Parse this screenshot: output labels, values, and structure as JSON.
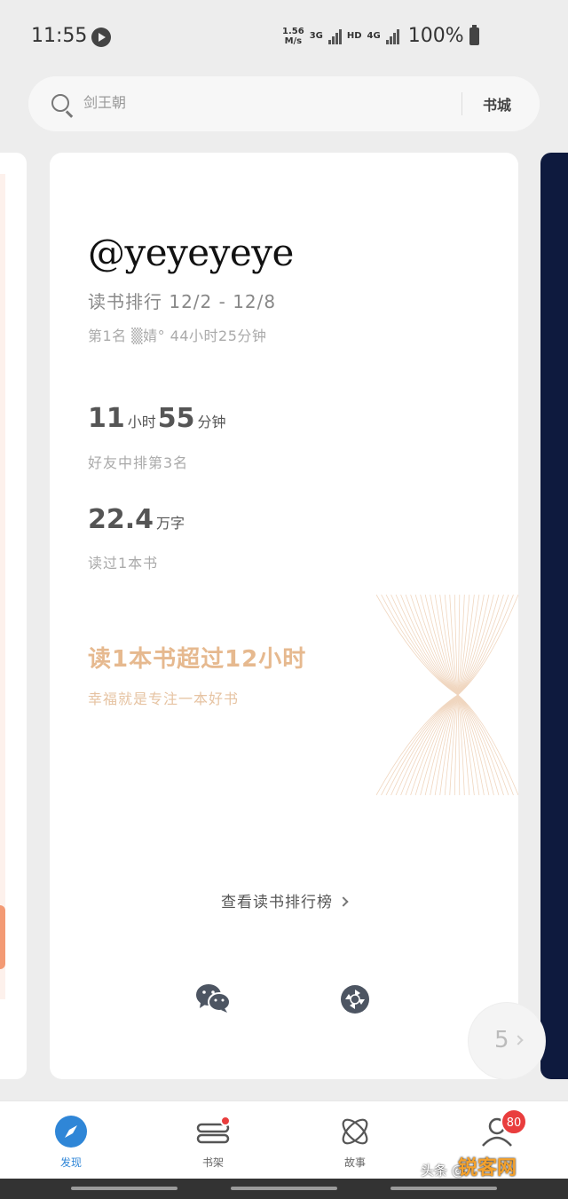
{
  "status_bar": {
    "time": "11:55",
    "speed_top": "1.56",
    "speed_bottom": "M/s",
    "net1": "3G",
    "hd": "HD",
    "net2": "4G",
    "battery": "100%"
  },
  "search": {
    "placeholder": "剑王朝",
    "bookstore_label": "书城"
  },
  "card": {
    "user_handle": "@yeyeyeye",
    "rank_title": "读书排行 12/2 - 12/8",
    "rank_first": "第1名 ▒婧° 44小时25分钟",
    "hours_value": "11",
    "hours_unit": "小时",
    "minutes_value": "55",
    "minutes_unit": "分钟",
    "time_rank": "好友中排第3名",
    "words_value": "22.4",
    "words_unit": "万字",
    "books_read": "读过1本书",
    "highlight_title": "读1本书超过12小时",
    "highlight_sub": "幸福就是专注一本好书",
    "leaderboard_link": "查看读书排行榜"
  },
  "page_indicator": {
    "page": "5"
  },
  "nav": {
    "items": [
      {
        "label": "发现",
        "icon": "compass-icon",
        "active": true
      },
      {
        "label": "书架",
        "icon": "bookshelf-icon",
        "badge": "dot"
      },
      {
        "label": "故事",
        "icon": "atom-icon"
      },
      {
        "label": "",
        "icon": "profile-icon",
        "badge": "80"
      }
    ]
  },
  "watermark": {
    "text": "头条 @",
    "logo": "锐客网"
  },
  "colors": {
    "accent": "#2f86d7",
    "highlight": "#e6b98f",
    "badge": "#e93d3d",
    "right_card": "#0e1a3e"
  }
}
